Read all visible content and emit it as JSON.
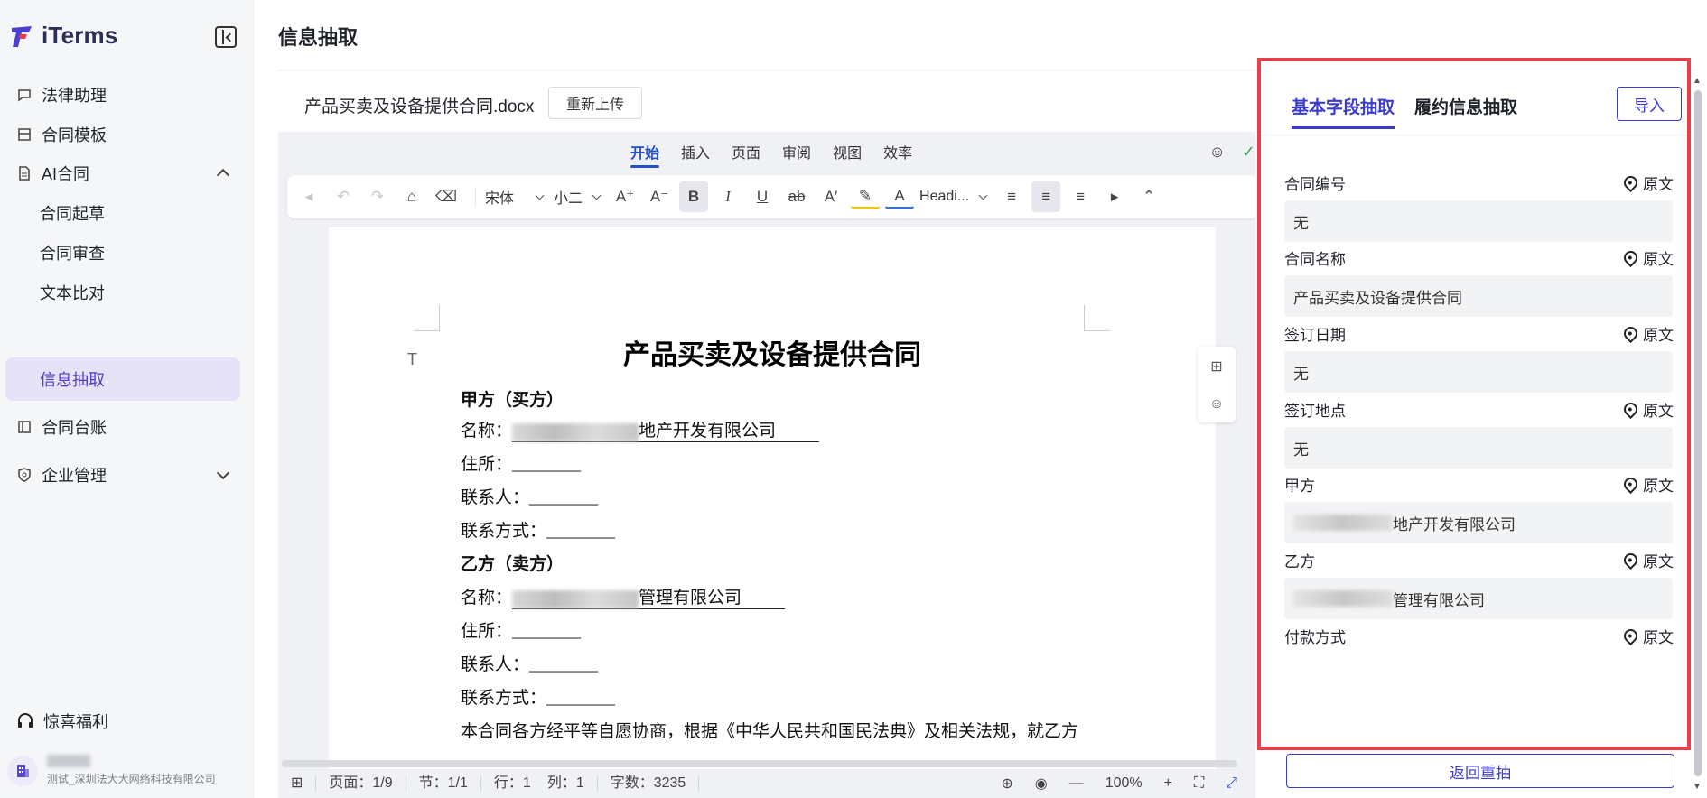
{
  "app": {
    "name": "iTerms"
  },
  "sidebar": {
    "items": [
      {
        "label": "法律助理"
      },
      {
        "label": "合同模板"
      },
      {
        "label": "AI合同"
      },
      {
        "label": "合同起草"
      },
      {
        "label": "合同审查"
      },
      {
        "label": "文本比对"
      },
      {
        "label": "信息抽取"
      },
      {
        "label": "合同台账"
      },
      {
        "label": "企业管理"
      }
    ],
    "gift_label": "惊喜福利",
    "user": {
      "org": "测试_深圳法大大网络科技有限公司"
    }
  },
  "header": {
    "title": "信息抽取",
    "file_name": "产品买卖及设备提供合同.docx",
    "reupload_label": "重新上传"
  },
  "editor": {
    "menu_tabs": [
      "开始",
      "插入",
      "页面",
      "审阅",
      "视图",
      "效率"
    ],
    "active_menu_tab": "开始",
    "toolbar": {
      "font_family": "宋体",
      "font_size": "小二",
      "heading_style": "Headi..."
    },
    "document": {
      "title": "产品买卖及设备提供合同",
      "party_a_heading": "甲方（买方）",
      "party_a_name_label": "名称：",
      "party_a_name_suffix": "地产开发有限公司",
      "address_label": "住所：________",
      "contact_label": "联系人：________",
      "contact_method_label": "联系方式：________",
      "party_b_heading": "乙方（卖方）",
      "party_b_name_label": "名称：",
      "party_b_name_suffix": "管理有限公司",
      "body_text": "本合同各方经平等自愿协商，根据《中华人民共和国民法典》及相关法规，就乙方"
    },
    "status": {
      "page": "页面：1/9",
      "section": "节：1/1",
      "row": "行：1",
      "col": "列：1",
      "word_count": "字数：3235",
      "zoom": "100%"
    }
  },
  "panel": {
    "tabs": [
      "基本字段抽取",
      "履约信息抽取"
    ],
    "active_tab": "基本字段抽取",
    "import_label": "导入",
    "source_label": "原文",
    "fields": [
      {
        "label": "合同编号",
        "value": "无"
      },
      {
        "label": "合同名称",
        "value": "产品买卖及设备提供合同"
      },
      {
        "label": "签订日期",
        "value": "无"
      },
      {
        "label": "签订地点",
        "value": "无"
      },
      {
        "label": "甲方",
        "value": "地产开发有限公司"
      },
      {
        "label": "乙方",
        "value": "管理有限公司"
      },
      {
        "label": "付款方式",
        "value": ""
      }
    ],
    "redo_label": "返回重抽"
  },
  "colors": {
    "accent": "#3b3ad0",
    "highlight_border": "#e8404a",
    "sidebar_active_bg": "#e6e3f7"
  }
}
